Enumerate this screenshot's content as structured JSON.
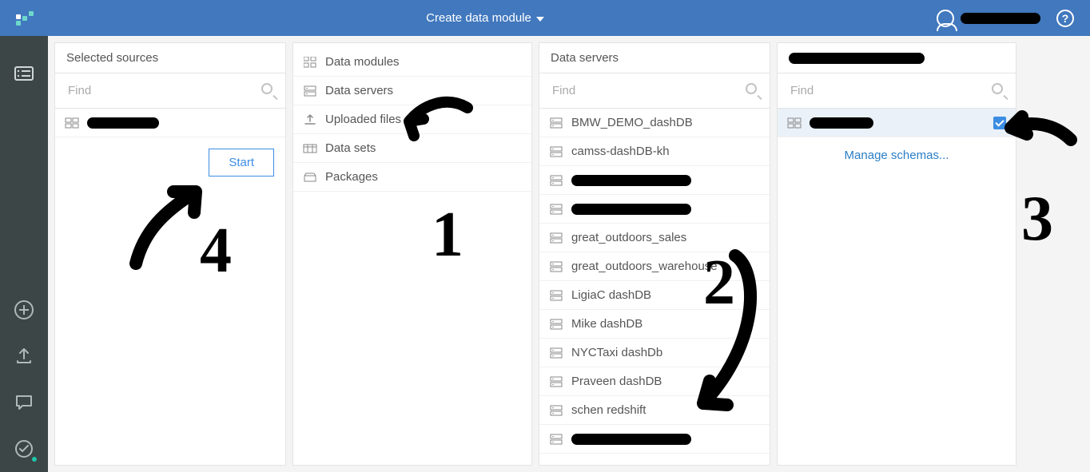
{
  "header": {
    "title": "Create data module"
  },
  "panels": {
    "sources": {
      "title": "Selected sources",
      "find_placeholder": "Find",
      "start_label": "Start"
    },
    "types": {
      "items": [
        {
          "label": "Data modules"
        },
        {
          "label": "Data servers"
        },
        {
          "label": "Uploaded files"
        },
        {
          "label": "Data sets"
        },
        {
          "label": "Packages"
        }
      ]
    },
    "servers": {
      "title": "Data servers",
      "find_placeholder": "Find",
      "items": [
        {
          "label": "BMW_DEMO_dashDB"
        },
        {
          "label": "camss-dashDB-kh"
        },
        {
          "label": "",
          "redacted": true
        },
        {
          "label": "",
          "redacted": true
        },
        {
          "label": "great_outdoors_sales"
        },
        {
          "label": "great_outdoors_warehouse"
        },
        {
          "label": "LigiaC dashDB"
        },
        {
          "label": "Mike dashDB"
        },
        {
          "label": "NYCTaxi dashDb"
        },
        {
          "label": "Praveen dashDB"
        },
        {
          "label": "schen redshift"
        },
        {
          "label": "",
          "redacted": true
        }
      ]
    },
    "schemas": {
      "find_placeholder": "Find",
      "manage_label": "Manage schemas..."
    }
  }
}
